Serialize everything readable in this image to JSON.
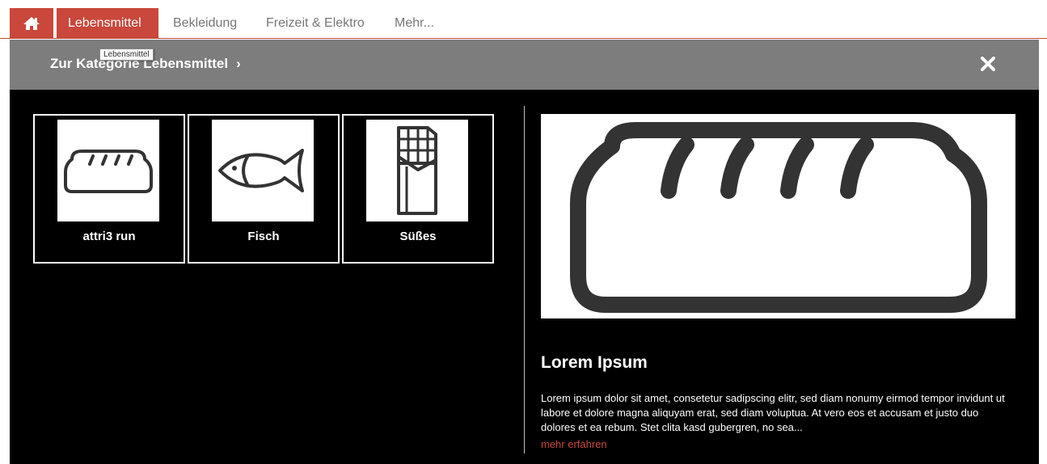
{
  "nav": {
    "home_icon": "home-icon",
    "tabs": [
      {
        "label": "Lebensmittel",
        "active": true
      },
      {
        "label": "Bekleidung",
        "active": false
      },
      {
        "label": "Freizeit & Elektro",
        "active": false
      },
      {
        "label": "Mehr...",
        "active": false
      }
    ],
    "tooltip": "Lebensmittel"
  },
  "header": {
    "category_link": "Zur Kategorie Lebensmittel",
    "chevron": "›",
    "close_icon": "close-icon"
  },
  "tiles": [
    {
      "label": "attri3 run",
      "icon": "bread-icon"
    },
    {
      "label": "Fisch",
      "icon": "fish-icon"
    },
    {
      "label": "Süßes",
      "icon": "chocolate-icon"
    }
  ],
  "preview": {
    "image_icon": "bread-icon",
    "title": "Lorem Ipsum",
    "text": "Lorem ipsum dolor sit amet, consetetur sadipscing elitr, sed diam nonumy eirmod tempor invidunt ut labore et dolore magna aliquyam erat, sed diam voluptua. At vero eos et accusam et justo duo dolores et ea rebum. Stet clita kasd gubergren, no sea...",
    "more_link": "mehr erfahren"
  },
  "colors": {
    "accent": "#c9473b",
    "header_grey": "#7d7d7d",
    "content_bg": "#000000"
  }
}
